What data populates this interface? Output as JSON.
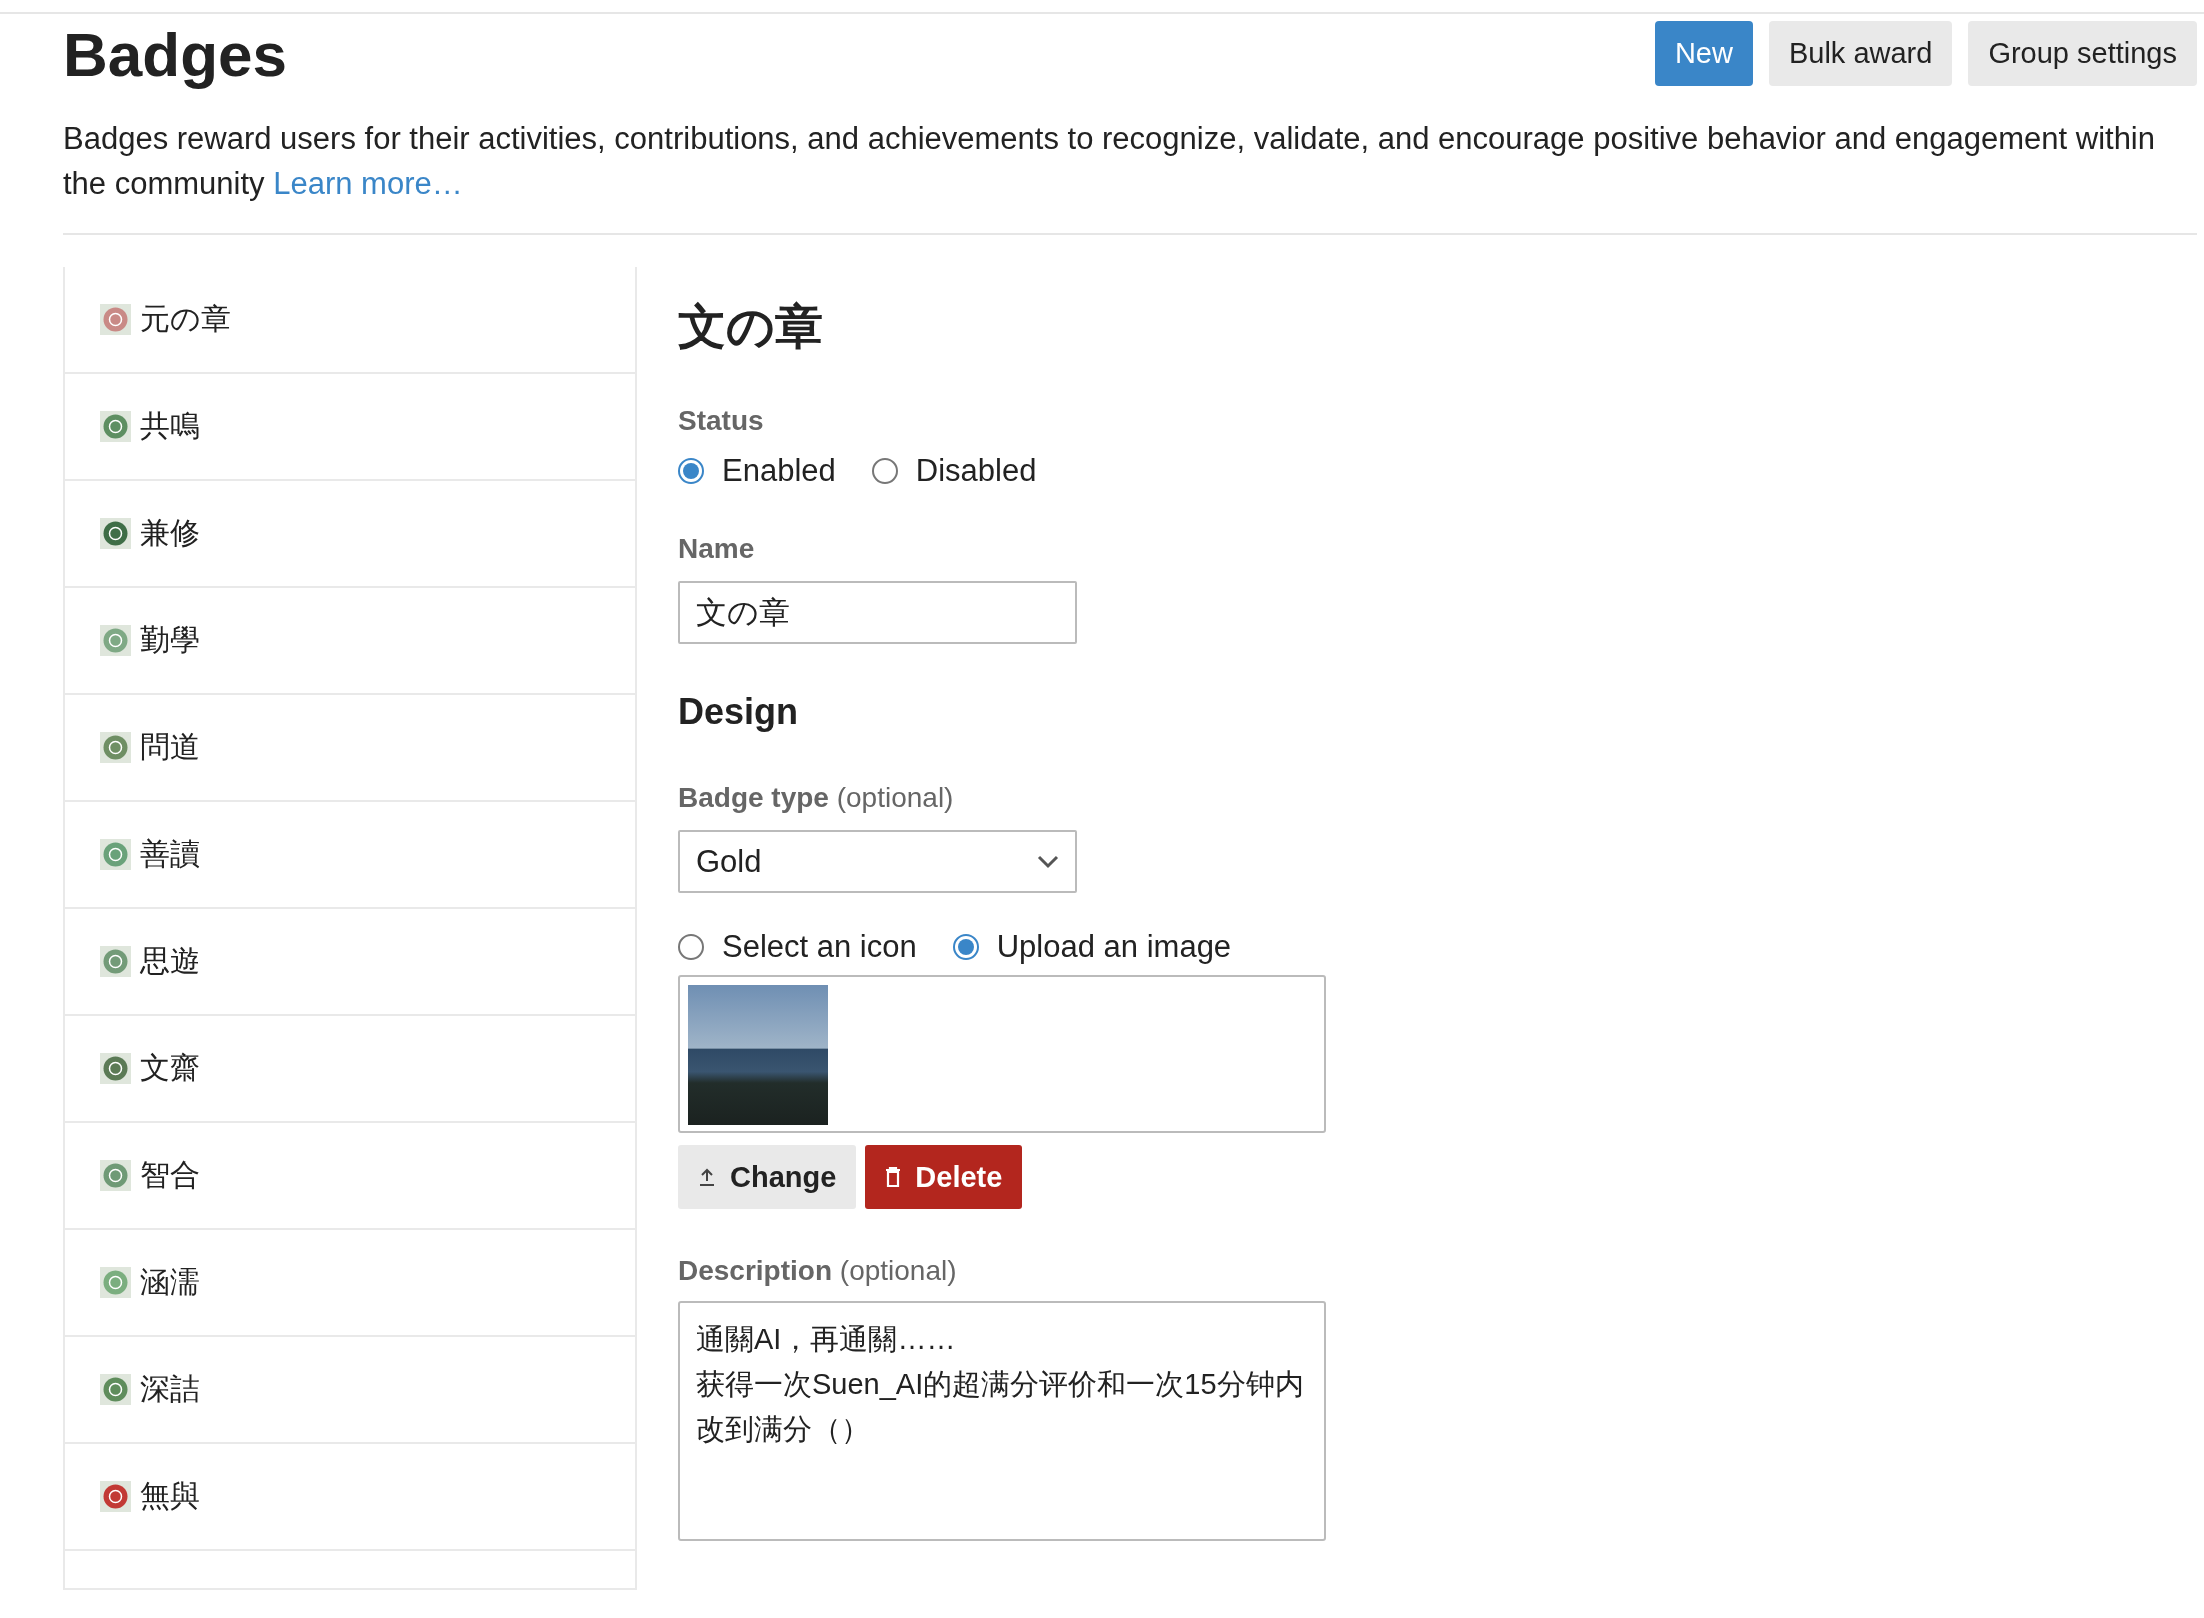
{
  "header": {
    "title": "Badges",
    "buttons": [
      {
        "label": "New",
        "kind": "primary"
      },
      {
        "label": "Bulk award",
        "kind": "secondary"
      },
      {
        "label": "Group settings",
        "kind": "secondary"
      }
    ],
    "description": "Badges reward users for their activities, contributions, and achievements to recognize, validate, and encourage positive behavior and engagement within the community",
    "link": "Learn more…"
  },
  "sidebar": {
    "items": [
      {
        "name": "元の章",
        "color": "#c98a86"
      },
      {
        "name": "共鳴",
        "color": "#5e8f62"
      },
      {
        "name": "兼修",
        "color": "#3f6e47"
      },
      {
        "name": "勤學",
        "color": "#7fa985"
      },
      {
        "name": "問道",
        "color": "#6f8f64"
      },
      {
        "name": "善讀",
        "color": "#6aa27a"
      },
      {
        "name": "思遊",
        "color": "#739b78"
      },
      {
        "name": "文齋",
        "color": "#5b7a55"
      },
      {
        "name": "智合",
        "color": "#6f9a76"
      },
      {
        "name": "涵濡",
        "color": "#7bae7f"
      },
      {
        "name": "深詰",
        "color": "#5f8d5c"
      },
      {
        "name": "無與",
        "color": "#c23a35"
      }
    ]
  },
  "form": {
    "heading": "文の章",
    "status": {
      "label": "Status",
      "options": [
        {
          "label": "Enabled",
          "selected": true
        },
        {
          "label": "Disabled",
          "selected": false
        }
      ]
    },
    "name": {
      "label": "Name",
      "value": "文の章"
    },
    "design_heading": "Design",
    "badge_type": {
      "label": "**Badge type** (optional)",
      "value": "Gold"
    },
    "image_source": [
      {
        "label": "Select an icon",
        "selected": false
      },
      {
        "label": "Upload an image",
        "selected": true
      }
    ],
    "image_buttons": [
      {
        "label": "Change",
        "kind": "change"
      },
      {
        "label": "Delete",
        "kind": "delete"
      }
    ],
    "description": {
      "label": "**Description** (optional)",
      "value": "通關AI，再通關……\n获得一次Suen_AI的超满分评价和一次15分钟内改到满分（）"
    }
  }
}
